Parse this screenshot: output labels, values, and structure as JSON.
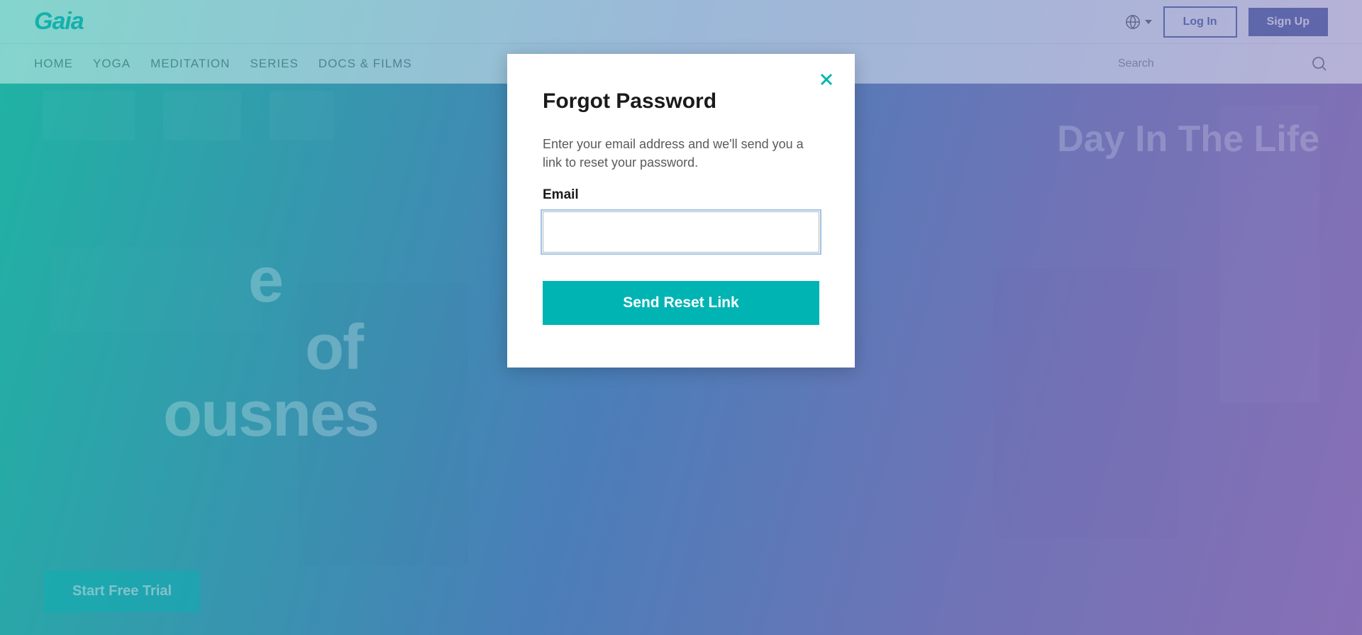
{
  "brand": {
    "name": "Gaia"
  },
  "header": {
    "login_label": "Log In",
    "signup_label": "Sign Up"
  },
  "nav": {
    "items": [
      "HOME",
      "YOGA",
      "MEDITATION",
      "SERIES",
      "DOCS & FILMS"
    ],
    "search_placeholder": "Search"
  },
  "hero": {
    "headline_partial_1": "e",
    "headline_partial_2": "of",
    "headline_partial_3": "ousnes",
    "right_text": "Day In The Life",
    "cta_label": "Start Free Trial"
  },
  "modal": {
    "title": "Forgot Password",
    "description": "Enter your email address and we'll send you a link to reset your password.",
    "email_label": "Email",
    "email_value": "",
    "submit_label": "Send Reset Link"
  },
  "colors": {
    "accent": "#01b4b4",
    "primary_button": "#44579a"
  }
}
